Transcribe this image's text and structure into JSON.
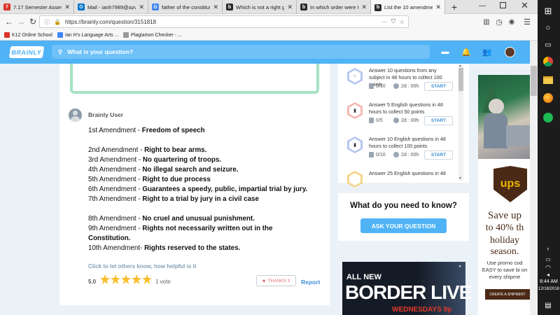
{
  "tabs": [
    {
      "title": "7.17 Semester Assessme",
      "icon": "k12-icon",
      "color": "#d9342b",
      "glyph": "7",
      "active": false
    },
    {
      "title": "Mail - ianh7989@azvaa",
      "icon": "outlook-icon",
      "color": "#0072c6",
      "glyph": "O",
      "active": false
    },
    {
      "title": "father of the constitutio",
      "icon": "google-icon",
      "color": "#4285f4",
      "glyph": "G",
      "active": false
    },
    {
      "title": "Which is not a right gu",
      "icon": "brainly-icon",
      "color": "#2b2b2b",
      "glyph": "b",
      "active": false
    },
    {
      "title": "In which order were th",
      "icon": "brainly-icon",
      "color": "#2b2b2b",
      "glyph": "b",
      "active": false
    },
    {
      "title": "List the 10 amendme",
      "icon": "brainly-icon",
      "color": "#2b2b2b",
      "glyph": "b",
      "active": true
    }
  ],
  "new_tab": "+",
  "url": "https://brainly.com/question/3151818",
  "bookmarks": [
    {
      "label": "K12 Online School",
      "icon": "k12-icon",
      "color": "#d9342b"
    },
    {
      "label": "Ian H's Language Arts ...",
      "icon": "bookmark-icon",
      "color": "#4285f4"
    },
    {
      "label": "Plagiarism Checker - ...",
      "icon": "bookmark-icon",
      "color": "#999999"
    }
  ],
  "header": {
    "logo": "BRAINLY",
    "search_placeholder": "What is your question?"
  },
  "answer": {
    "user": "Brainly User",
    "amendments": [
      {
        "label": "1st Amendment - ",
        "text": "Freedom of speech"
      },
      {
        "label": "2nd Amendment - ",
        "text": "Right to bear arms."
      },
      {
        "label": "3rd Amendment - ",
        "text": "No quartering of troops."
      },
      {
        "label": "4th Amendment - ",
        "text": "No illegal search and seizure."
      },
      {
        "label": "5th Amendment - ",
        "text": "Right to due process"
      },
      {
        "label": "6th Amendment - ",
        "text": "Guarantees a speedy, public, impartial trial by jury."
      },
      {
        "label": "7th Amendment - ",
        "text": "Right to a trial by jury in a civil case"
      },
      {
        "label": "8th Amendment - ",
        "text": "No cruel and unusual punishment."
      },
      {
        "label": "9th Amendment - ",
        "text": "Rights not necessarily written out in the"
      },
      {
        "label": "",
        "text": "Constitution."
      },
      {
        "label": "10th Amendment- ",
        "text": "Rights reserved to the states."
      }
    ],
    "help_text": "Click to let others know, how helpful is it",
    "rating": "5.0",
    "stars": 5,
    "votes": "1 vote",
    "thanks": "THANKS 3",
    "report": "Report"
  },
  "challenges": [
    {
      "text": "Answer 10 questions from any subject in 48 hours to collect 100 points",
      "progress": "0/10",
      "time": "2d : 00h",
      "start": "START",
      "color": "#b7c7f0",
      "glyph": "⁘"
    },
    {
      "text": "Answer 5 English questions in 48 hours to collect 50 points",
      "progress": "0/5",
      "time": "2d : 00h",
      "start": "START",
      "color": "#f4b9b2",
      "glyph": "▮"
    },
    {
      "text": "Answer 10 English questions in 48 hours to collect 100 points",
      "progress": "0/10",
      "time": "2d : 00h",
      "start": "START",
      "color": "#b7c7f0",
      "glyph": "▮"
    },
    {
      "text": "Answer 25 English questions in 48",
      "progress": "",
      "time": "",
      "start": "",
      "color": "#f6d58a",
      "glyph": ""
    }
  ],
  "need": {
    "title": "What do you need to know?",
    "button": "ASK YOUR QUESTION"
  },
  "video_ad": {
    "line1": "ALL NEW",
    "line2": "BORDER LIVE",
    "line3": "WEDNESDAYS 9p"
  },
  "ups_ad": {
    "logo": "ups",
    "headline": [
      "Save up",
      "to 40% th",
      "holiday",
      "season."
    ],
    "promo": "Use promo cod EASY to save bi on every shipme",
    "button": "CREATE A SHIPMENT"
  },
  "taskbar": {
    "time": "8:44 AM",
    "date": "12/18/2018"
  }
}
